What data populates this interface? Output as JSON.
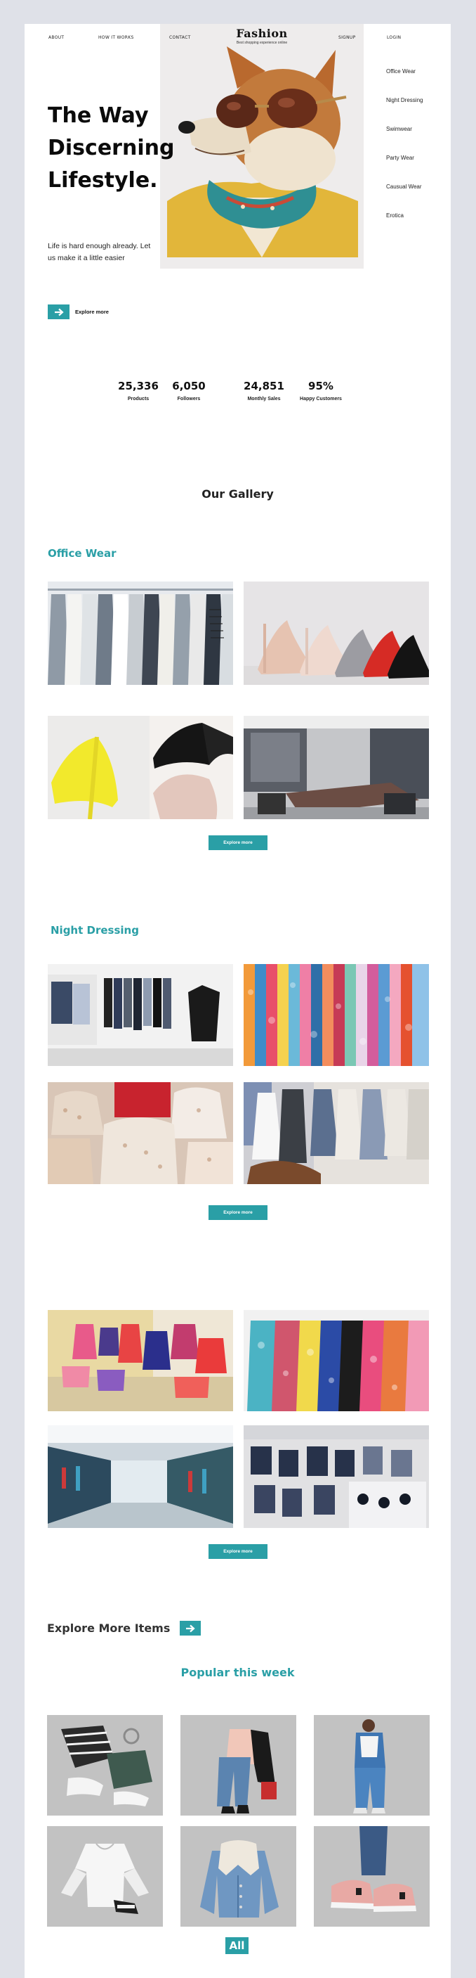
{
  "nav": {
    "about": "ABOUT",
    "how_it_works": "HOW IT WORKS",
    "contact": "CONTACT",
    "signup": "SIGNUP",
    "login": "LOGIN"
  },
  "brand": {
    "title": "Fashion",
    "subtitle": "Best shopping experience online"
  },
  "hero": {
    "title_lines": [
      "The Way",
      "Discerning",
      "Lifestyle."
    ],
    "description": "Life is hard enough already. Let us make it a little easier",
    "explore_label": "Explore more"
  },
  "side_categories": [
    "Office Wear",
    "Night Dressing",
    "Swimwear",
    "Party Wear",
    "Causual Wear",
    "Erotica"
  ],
  "stats": [
    {
      "value": "25,336",
      "label": "Products"
    },
    {
      "value": "6,050",
      "label": "Followers"
    },
    {
      "value": "24,851",
      "label": "Monthly Sales"
    },
    {
      "value": "95%",
      "label": "Happy Customers"
    }
  ],
  "gallery": {
    "title": "Our Gallery",
    "sections": [
      {
        "title": "Office Wear",
        "cta": "Explore more"
      },
      {
        "title": "Night Dressing",
        "cta": "Explore more"
      },
      {
        "title": "",
        "cta": "Explore more"
      }
    ]
  },
  "explore_more_items": "Explore More Items",
  "popular": {
    "title": "Popular this week",
    "all_label": "All"
  },
  "colors": {
    "accent": "#2a9fa6",
    "background": "#dfe1e8",
    "tile": "#c2c2c2"
  }
}
